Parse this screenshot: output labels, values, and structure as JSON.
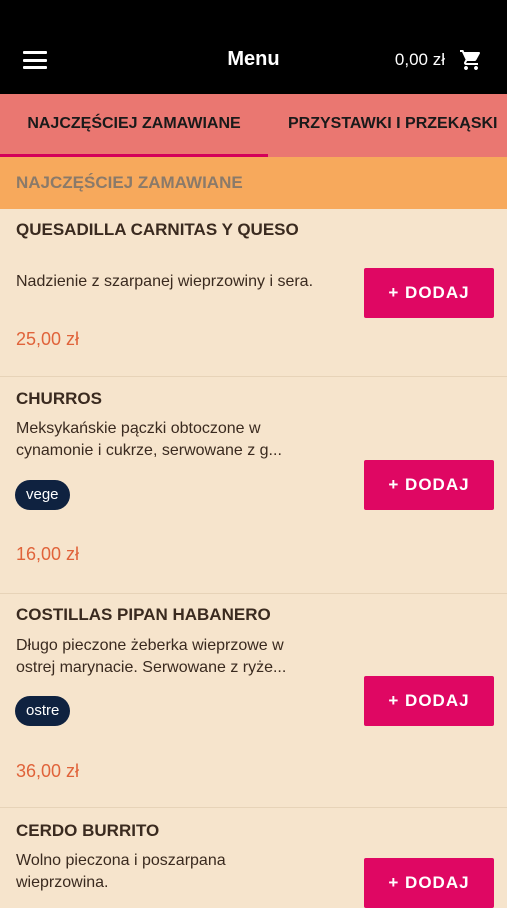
{
  "header": {
    "title": "Menu",
    "cart_total": "0,00 zł",
    "menu_icon": "hamburger-menu-icon",
    "cart_icon": "shopping-cart-icon"
  },
  "tabs": [
    {
      "label": "NAJCZĘŚCIEJ ZAMAWIANE",
      "active": true
    },
    {
      "label": "PRZYSTAWKI I PRZEKĄSKI",
      "active": false
    }
  ],
  "section": {
    "title": "NAJCZĘŚCIEJ ZAMAWIANE"
  },
  "items": [
    {
      "name": "QUESADILLA CARNITAS Y QUESO",
      "description": "Nadzienie z szarpanej wieprzowiny i sera.",
      "price": "25,00 zł",
      "button": "+ DODAJ"
    },
    {
      "name": "CHURROS",
      "description": "Meksykańskie pączki obtoczone w cynamonie i cukrze, serwowane z g...",
      "tag": "vege",
      "price": "16,00 zł",
      "button": "+ DODAJ"
    },
    {
      "name": "COSTILLAS PIPAN HABANERO",
      "description": "Długo pieczone żeberka wieprzowe w ostrej marynacie. Serwowane z ryże...",
      "tag": "ostre",
      "price": "36,00 zł",
      "button": "+ DODAJ"
    },
    {
      "name": "CERDO BURRITO",
      "description": "Wolno pieczona i poszarpana wieprzowina.",
      "button": "+ DODAJ"
    }
  ],
  "colors": {
    "topbar": "#000000",
    "tabs_bg": "#ea7771",
    "section_bg": "#f7a95c",
    "content_bg": "#f6e4cc",
    "accent": "#df0763",
    "price": "#e0633a",
    "tag_bg": "#0f2240"
  }
}
